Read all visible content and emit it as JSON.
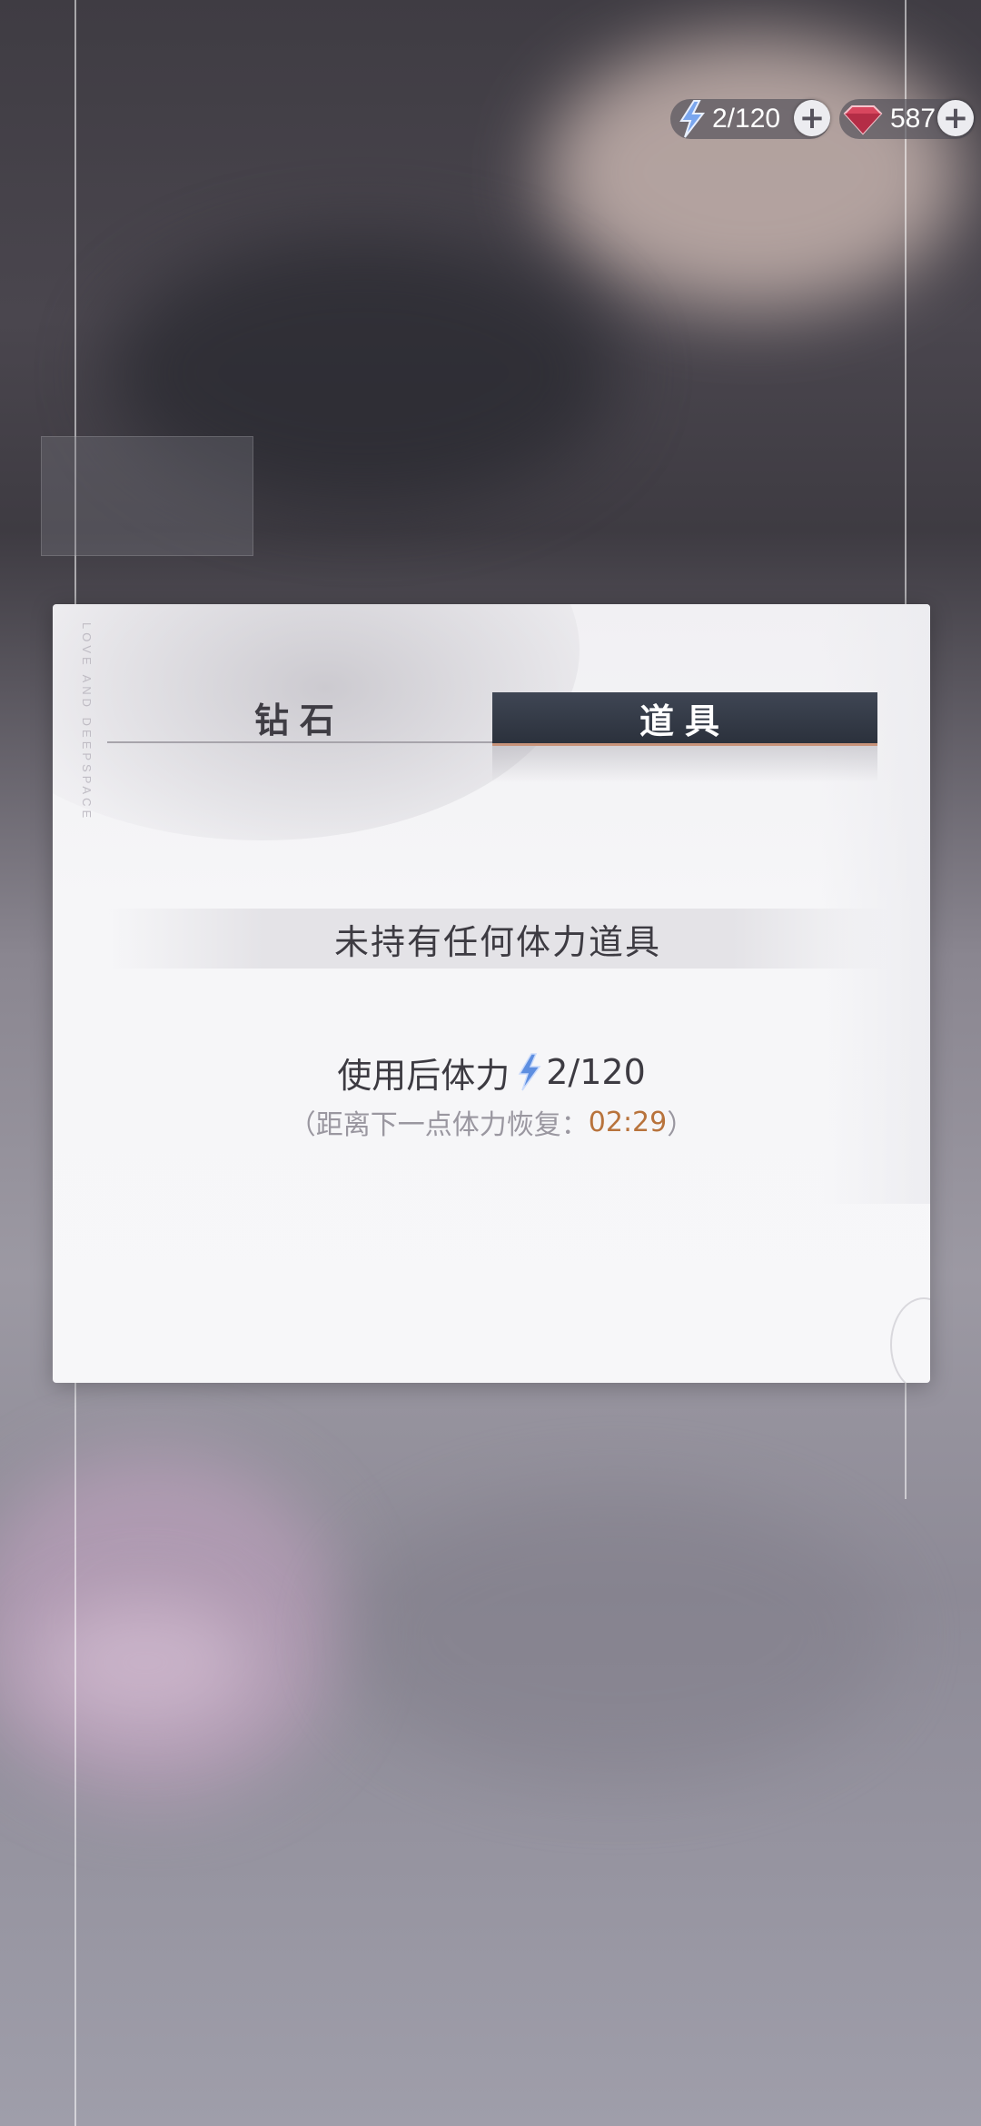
{
  "resources": {
    "stamina": "2/120",
    "diamonds": "587",
    "plus_symbol": "+"
  },
  "dialog": {
    "side_text": "LOVE AND DEEPSPACE",
    "tabs": [
      {
        "label": "钻石",
        "active": false
      },
      {
        "label": "道具",
        "active": true
      }
    ],
    "empty_message": "未持有任何体力道具",
    "after_use_label": "使用后体力",
    "after_use_value": "2/120",
    "recovery_prefix": "（距离下一点体力恢复：",
    "recovery_timer": "02:29",
    "recovery_suffix": "）"
  },
  "colors": {
    "active_tab_bg": "#2f3540",
    "tab_underline_accent": "#c8937a",
    "timer": "#b8733c",
    "stamina_icon": "#4f7fd8"
  }
}
